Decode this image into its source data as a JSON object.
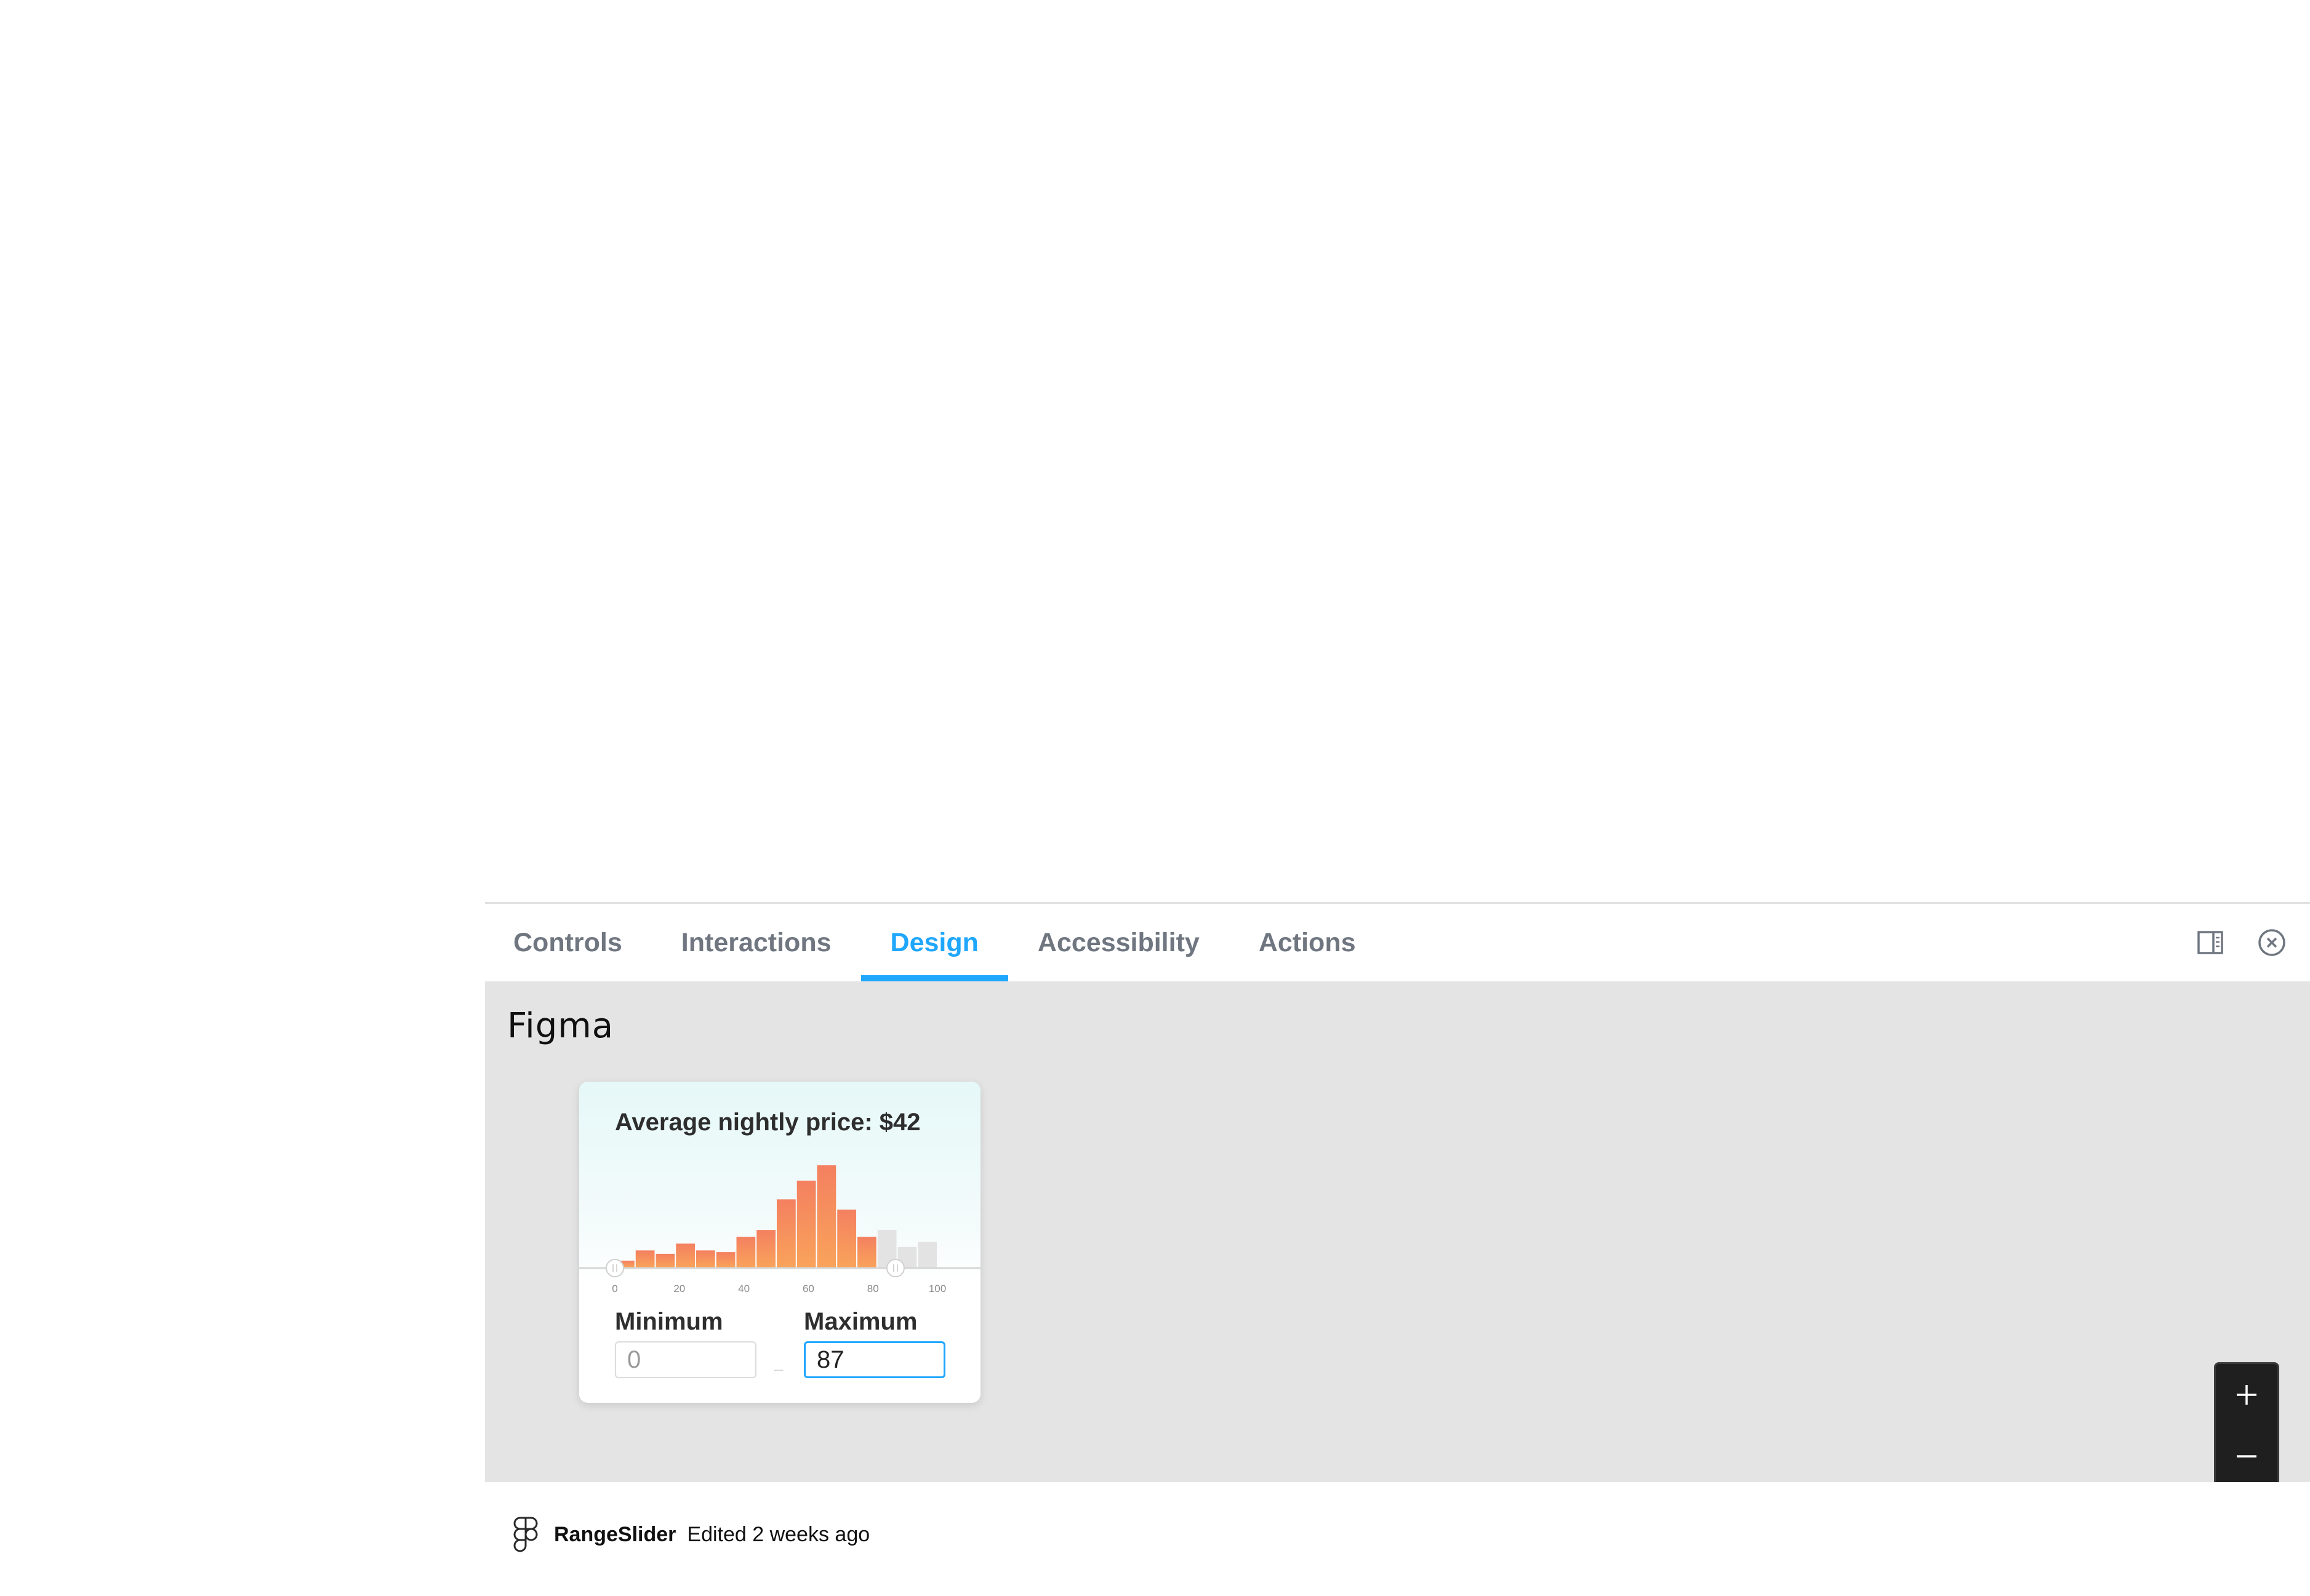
{
  "tabs": [
    {
      "label": "Controls",
      "active": false
    },
    {
      "label": "Interactions",
      "active": false
    },
    {
      "label": "Design",
      "active": true
    },
    {
      "label": "Accessibility",
      "active": false
    },
    {
      "label": "Actions",
      "active": false
    }
  ],
  "toolbar": {
    "orientation_icon": "panel-layout-icon",
    "close_icon": "close-circle-icon"
  },
  "design": {
    "provider_title": "Figma",
    "card": {
      "title": "Average nightly price: $42",
      "min_label": "Minimum",
      "max_label": "Maximum",
      "min_value": "0",
      "max_value": "87",
      "dash": "–"
    }
  },
  "chart_data": {
    "type": "bar",
    "title": "Average nightly price: $42",
    "x_ticks": [
      "0",
      "20",
      "40",
      "60",
      "80",
      "100"
    ],
    "xlim": [
      0,
      100
    ],
    "bin_width": 6.25,
    "values": [
      2,
      5,
      4,
      7,
      5,
      4.5,
      9,
      11,
      20,
      25.5,
      30,
      17,
      9,
      11,
      6,
      7.5
    ],
    "selected_range": [
      0,
      87
    ],
    "colors": {
      "selected": "#f48a5c",
      "unselected": "#e3e3e3"
    }
  },
  "zoom": {
    "zoom_in_icon": "plus-icon",
    "zoom_out_icon": "minus-icon"
  },
  "footer": {
    "icon": "figma-logo-icon",
    "component_name": "RangeSlider",
    "status": "Edited 2 weeks ago"
  },
  "colors": {
    "accent": "#1ea7fd",
    "tab_text": "#6f7680",
    "design_bg": "#e4e4e4"
  }
}
